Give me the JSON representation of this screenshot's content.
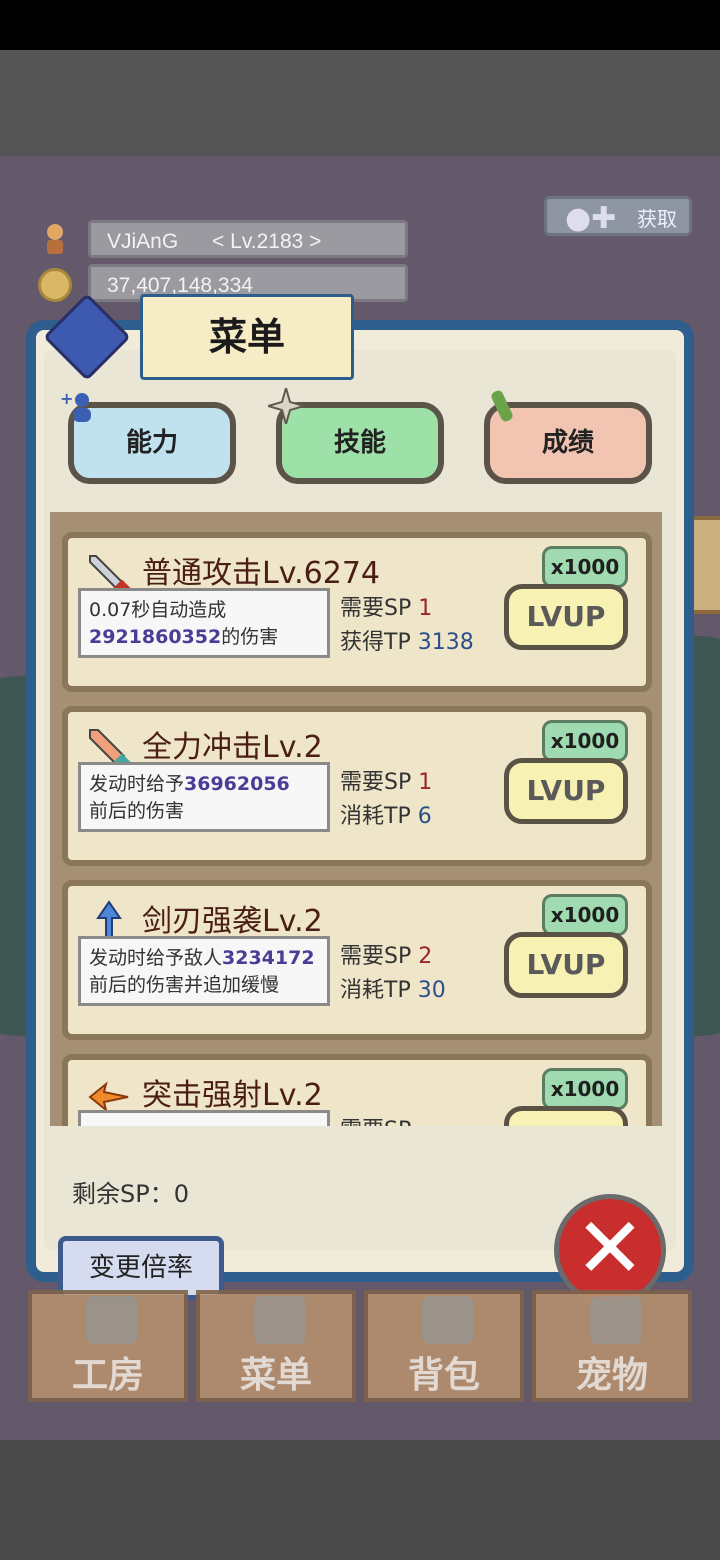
{
  "hud": {
    "player_name": "VJiAnG",
    "player_level": "< Lv.2183 >",
    "gold": "37,407,148,334",
    "ad_button_label": "获取"
  },
  "panel": {
    "title": "菜单",
    "tabs": [
      {
        "label": "能力"
      },
      {
        "label": "技能"
      },
      {
        "label": "成绩"
      }
    ],
    "skills": [
      {
        "name": "普通攻击Lv.6274",
        "multiplier": "x1000",
        "desc_line1_pre": "0.07秒自动造成",
        "desc_line1_val": "",
        "desc_line2_val": "2921860352",
        "desc_line2_post": "的伤害",
        "sp_label": "需要SP",
        "sp_value": "1",
        "tp_label": "获得TP",
        "tp_value": "3138",
        "button": "LVUP"
      },
      {
        "name": "全力冲击Lv.2",
        "multiplier": "x1000",
        "desc_line1_pre": "发动时给予",
        "desc_line1_val": "36962056",
        "desc_line2_val": "",
        "desc_line2_post": "前后的伤害",
        "sp_label": "需要SP",
        "sp_value": "1",
        "tp_label": "消耗TP",
        "tp_value": "6",
        "button": "LVUP"
      },
      {
        "name": "剑刃强袭Lv.2",
        "multiplier": "x1000",
        "desc_line1_pre": "发动时给予敌人",
        "desc_line1_val": "3234172",
        "desc_line2_val": "",
        "desc_line2_post": "前后的伤害并追加缓慢",
        "sp_label": "需要SP",
        "sp_value": "2",
        "tp_label": "消耗TP",
        "tp_value": "30",
        "button": "LVUP"
      },
      {
        "name": "突击强射Lv.2",
        "multiplier": "x1000",
        "desc_line1_pre": "",
        "desc_line1_val": "",
        "desc_line2_val": "",
        "desc_line2_post": "",
        "sp_label": "需要SP",
        "sp_value": "",
        "tp_label": "",
        "tp_value": "",
        "button": "LVUP"
      }
    ],
    "remaining_sp": "剩余SP：0",
    "change_rate_label": "变更倍率",
    "close_label": "✕"
  },
  "nav": [
    {
      "label": "工房"
    },
    {
      "label": "菜单"
    },
    {
      "label": "背包"
    },
    {
      "label": "宠物"
    }
  ],
  "colors": {
    "panel_border": "#2d5e8e",
    "card_bg": "#efe5c8",
    "lvup_bg": "#f7f2b3",
    "multiplier_bg": "#9fdab0",
    "close_red": "#c92e2e"
  }
}
